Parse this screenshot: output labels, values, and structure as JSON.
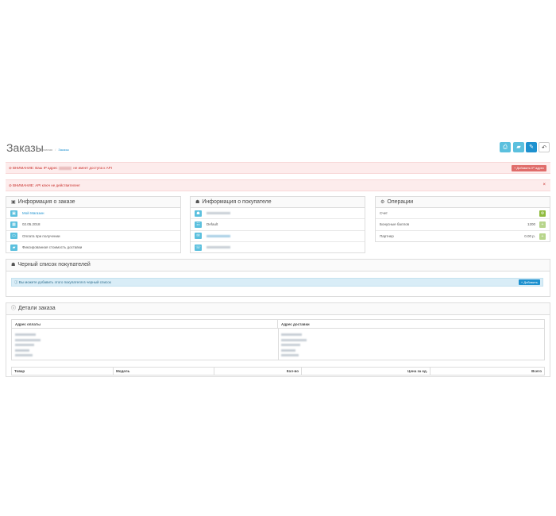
{
  "page": {
    "title": "Заказы",
    "breadcrumb": [
      "Главная",
      "Заказы"
    ]
  },
  "toolbar": {
    "buttons": [
      {
        "name": "print-invoice-button",
        "icon": "print-icon",
        "glyph": "⎙"
      },
      {
        "name": "print-shipping-button",
        "icon": "truck-icon",
        "glyph": "▰"
      },
      {
        "name": "edit-button",
        "icon": "pencil-icon",
        "glyph": "✎"
      },
      {
        "name": "back-button",
        "icon": "reply-icon",
        "glyph": "↶"
      }
    ]
  },
  "alerts": {
    "ip_prefix": "⊘ ВНИМАНИЕ: Ваш IP адрес",
    "ip_suffix": "не имеет доступа к API",
    "ip_button": "+ Добавить IP адрес",
    "api_text": "⊘ ВНИМАНИЕ: API ключ не действителен!",
    "close": "×"
  },
  "order_info": {
    "title": "Информация о заказе",
    "icon": "cart-icon",
    "rows": [
      {
        "icon": "shopping-cart-icon",
        "glyph": "▣",
        "text": "Мой Магазин",
        "link": true
      },
      {
        "icon": "calendar-icon",
        "glyph": "▦",
        "text": "02.05.2018"
      },
      {
        "icon": "credit-card-icon",
        "glyph": "▭",
        "text": "Оплата при получении"
      },
      {
        "icon": "truck-icon",
        "glyph": "▰",
        "text": "Фиксированная стоимость доставки"
      }
    ]
  },
  "customer_info": {
    "title": "Информация о покупателе",
    "icon": "user-icon",
    "rows": [
      {
        "icon": "user-icon",
        "glyph": "☗",
        "text": ""
      },
      {
        "icon": "group-icon",
        "glyph": "☷",
        "text": "Default"
      },
      {
        "icon": "envelope-icon",
        "glyph": "✉",
        "text": ""
      },
      {
        "icon": "phone-icon",
        "glyph": "☏",
        "text": ""
      }
    ]
  },
  "operations": {
    "title": "Операции",
    "icon": "cog-icon",
    "rows": [
      {
        "label": "Счет",
        "value": "",
        "button": "cog-button",
        "faded": false
      },
      {
        "label": "Бонусные баллов",
        "value": "1200",
        "button": "plus-button",
        "faded": true
      },
      {
        "label": "Партнер",
        "value": "0.00 р.",
        "button": "plus-button",
        "faded": true
      }
    ]
  },
  "blacklist": {
    "title": "Черный список покупателей",
    "info": "ⓘ Вы можете добавить этого покупателя в черный список",
    "add_button": "+ Добавить"
  },
  "details": {
    "title": "Детали заказа",
    "payment_address": "Адрес оплаты",
    "shipping_address": "Адрес доставки",
    "columns": [
      "Товар",
      "Модель",
      "Кол-во",
      "Цена за ед.",
      "Всего"
    ]
  }
}
